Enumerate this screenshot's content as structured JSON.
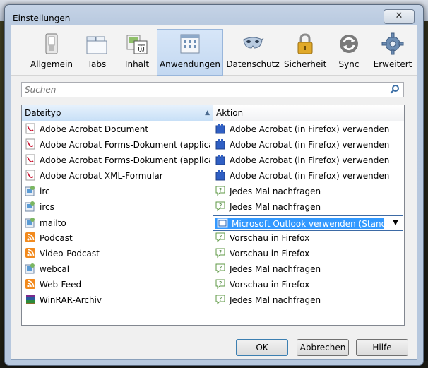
{
  "window": {
    "title": "Einstellungen",
    "close_label": "✕"
  },
  "toolbar": {
    "items": [
      {
        "label": "Allgemein",
        "icon": "switch-icon"
      },
      {
        "label": "Tabs",
        "icon": "tabs-icon"
      },
      {
        "label": "Inhalt",
        "icon": "content-icon"
      },
      {
        "label": "Anwendungen",
        "icon": "applications-icon",
        "selected": true
      },
      {
        "label": "Datenschutz",
        "icon": "mask-icon"
      },
      {
        "label": "Sicherheit",
        "icon": "padlock-icon"
      },
      {
        "label": "Sync",
        "icon": "sync-icon"
      },
      {
        "label": "Erweitert",
        "icon": "gear-icon"
      }
    ]
  },
  "search": {
    "placeholder": "Suchen"
  },
  "table": {
    "headers": {
      "type": "Dateityp",
      "action": "Aktion"
    },
    "rows": [
      {
        "type": "Adobe Acrobat Document",
        "type_icon": "pdf-icon",
        "action": "Adobe Acrobat (in Firefox) verwenden",
        "action_icon": "plugin-icon"
      },
      {
        "type": "Adobe Acrobat Forms-Dokument (applicati...",
        "type_icon": "pdf-icon",
        "action": "Adobe Acrobat (in Firefox) verwenden",
        "action_icon": "plugin-icon"
      },
      {
        "type": "Adobe Acrobat Forms-Dokument (applicati...",
        "type_icon": "pdf-icon",
        "action": "Adobe Acrobat (in Firefox) verwenden",
        "action_icon": "plugin-icon"
      },
      {
        "type": "Adobe Acrobat XML-Formular",
        "type_icon": "pdf-icon",
        "action": "Adobe Acrobat (in Firefox) verwenden",
        "action_icon": "plugin-icon"
      },
      {
        "type": "irc",
        "type_icon": "application-icon",
        "action": "Jedes Mal nachfragen",
        "action_icon": "ask-icon"
      },
      {
        "type": "ircs",
        "type_icon": "application-icon",
        "action": "Jedes Mal nachfragen",
        "action_icon": "ask-icon"
      },
      {
        "type": "mailto",
        "type_icon": "application-icon",
        "action": "Microsoft Outlook verwenden (Standard)",
        "action_icon": "outlook-icon",
        "selected": true
      },
      {
        "type": "Podcast",
        "type_icon": "feed-icon",
        "action": "Vorschau in Firefox",
        "action_icon": "ask-icon"
      },
      {
        "type": "Video-Podcast",
        "type_icon": "feed-icon",
        "action": "Vorschau in Firefox",
        "action_icon": "ask-icon"
      },
      {
        "type": "webcal",
        "type_icon": "application-icon",
        "action": "Jedes Mal nachfragen",
        "action_icon": "ask-icon"
      },
      {
        "type": "Web-Feed",
        "type_icon": "feed-icon",
        "action": "Vorschau in Firefox",
        "action_icon": "ask-icon"
      },
      {
        "type": "WinRAR-Archiv",
        "type_icon": "winrar-icon",
        "action": "Jedes Mal nachfragen",
        "action_icon": "ask-icon"
      }
    ]
  },
  "buttons": {
    "ok": "OK",
    "cancel": "Abbrechen",
    "help": "Hilfe"
  },
  "colors": {
    "selection": "#3399ff",
    "header_sorted": "#c8e0f7",
    "toolbar_selected": "#c3d8f1"
  }
}
